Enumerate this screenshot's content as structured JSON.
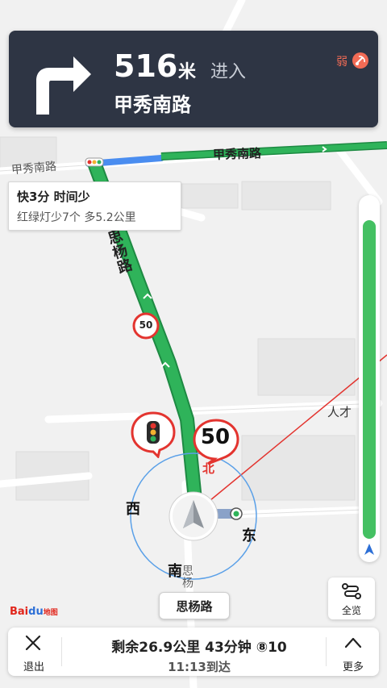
{
  "nav": {
    "distance": "516",
    "unit": "米",
    "action": "进入",
    "road": "甲秀南路",
    "gps_signal": "弱"
  },
  "map": {
    "road_top_right": "甲秀南路",
    "road_top_left": "甲秀南路",
    "road_vertical": "思杨路",
    "road_bottom_vertical": "思杨",
    "road_right": "人才",
    "speed_limit_small": "50",
    "speed_limit_big": "50",
    "compass": {
      "north": "北",
      "south": "南",
      "east": "东",
      "west": "西"
    }
  },
  "route_tip": {
    "title": "快3分  时间少",
    "subtitle": "红绿灯少7个  多5.2公里"
  },
  "current_road": "思杨路",
  "overview": {
    "label": "全览"
  },
  "logo": {
    "brand": "Bai",
    "brand_blue": "du",
    "sub": "地图"
  },
  "progress": {
    "fraction": 0.94
  },
  "bottom": {
    "exit_label": "退出",
    "summary": "剩余26.9公里  43分钟  ⑧10",
    "eta": "11:13到达",
    "more_label": "更多"
  },
  "colors": {
    "route": "#2fb35a",
    "card_bg": "#2e3544",
    "warning_red": "#e3342f"
  }
}
